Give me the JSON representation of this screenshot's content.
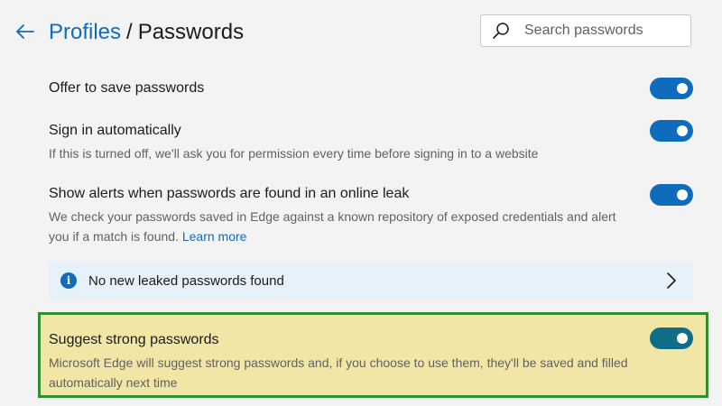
{
  "header": {
    "breadcrumb_parent": "Profiles",
    "breadcrumb_separator": "/",
    "breadcrumb_current": "Passwords",
    "back_icon": "arrow-left-icon"
  },
  "search": {
    "placeholder": "Search passwords",
    "value": "",
    "icon": "search-icon"
  },
  "settings": [
    {
      "title": "Offer to save passwords",
      "enabled": true
    },
    {
      "title": "Sign in automatically",
      "description": "If this is turned off, we'll ask you for permission every time before signing in to a website",
      "enabled": true
    },
    {
      "title": "Show alerts when passwords are found in an online leak",
      "description": "We check your passwords saved in Edge against a known repository of exposed credentials and alert you if a match is found.",
      "link": "Learn more",
      "enabled": true
    }
  ],
  "leak_banner": {
    "text": "No new leaked passwords found",
    "icon": "info-icon",
    "info_glyph": "i",
    "action_icon": "chevron-right-icon"
  },
  "suggest": {
    "title": "Suggest strong passwords",
    "description": "Microsoft Edge will suggest strong passwords and, if you choose to use them, they'll be saved and filled automatically next time",
    "enabled": true
  },
  "colors": {
    "accent": "#0f6cbd",
    "toggle_highlight": "#0f6d87",
    "background": "#f3f3f3",
    "highlight_fill": "#f1e6a6",
    "highlight_border": "#2e8f2e",
    "banner": "#e6f1fa"
  }
}
